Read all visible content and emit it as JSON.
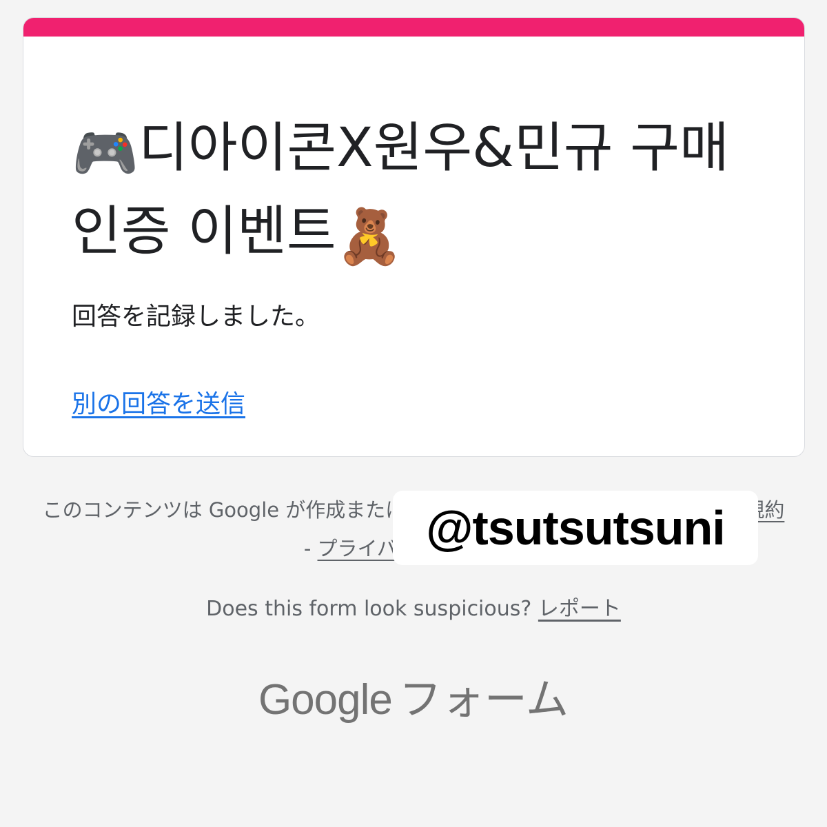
{
  "form": {
    "accent_color": "#f0216f",
    "title_icon_start": "🎮",
    "title": "디아이콘X원우&민규 구매 인증 이벤트",
    "title_icon_end": "🧸",
    "confirmation_message": "回答を記録しました。",
    "submit_another_link": "別の回答を送信"
  },
  "footer": {
    "disclaimer_text": "このコンテンツは Google が作成または承認したものではありません。",
    "separator": " - ",
    "terms_link": "利用規約",
    "privacy_link": "プライバシー ポリシー",
    "suspicious_prompt": "Does this form look suspicious?",
    "report_link": "レポート",
    "brand_google": "Google",
    "brand_forms": "フォーム"
  },
  "overlay": {
    "watermark_text": "@tsutsutsuni"
  }
}
